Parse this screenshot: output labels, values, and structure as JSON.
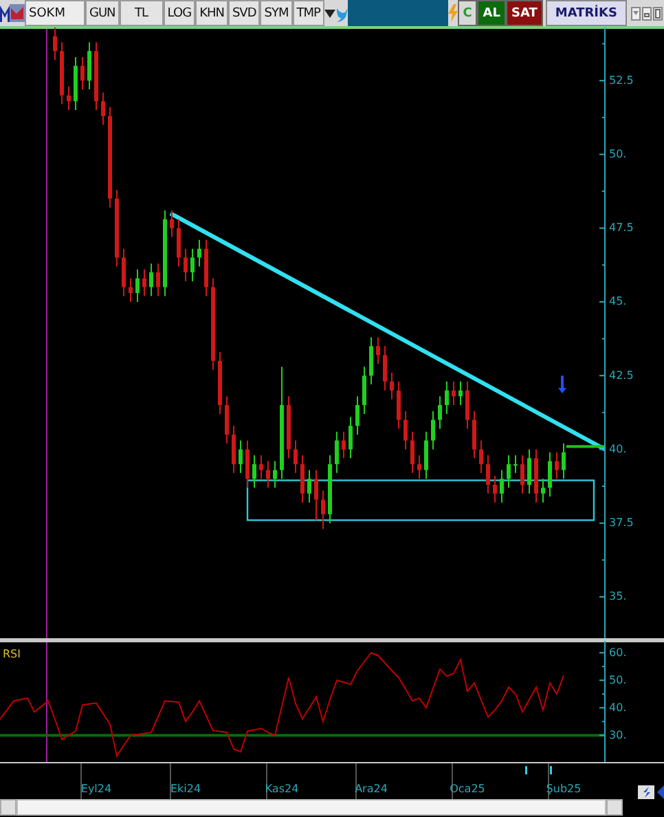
{
  "toolbar": {
    "symbol": "SOKM",
    "buttons": [
      "GUN",
      "TL",
      "LOG",
      "KHN",
      "SVD",
      "SYM",
      "TMP"
    ],
    "actions": [
      {
        "label": "C",
        "kind": "refresh"
      },
      {
        "label": "AL",
        "kind": "buy"
      },
      {
        "label": "SAT",
        "kind": "sell"
      }
    ],
    "brand": "MATRİKS"
  },
  "price_panel": {
    "drawings": [
      {
        "kind": "cursor-line"
      },
      {
        "kind": "trendline"
      },
      {
        "kind": "range-box"
      },
      {
        "kind": "level-line"
      },
      {
        "kind": "arrow"
      }
    ],
    "chart_data": {
      "type": "candlestick",
      "ylim": [
        33.6,
        54.3
      ],
      "yticks": [
        {
          "value": 35,
          "label": "35."
        },
        {
          "value": 37.5,
          "label": "37.5"
        },
        {
          "value": 40,
          "label": "40."
        },
        {
          "value": 42.5,
          "label": "42.5"
        },
        {
          "value": 45,
          "label": "45."
        },
        {
          "value": 47.5,
          "label": "47.5"
        },
        {
          "value": 50,
          "label": "50."
        },
        {
          "value": 52.5,
          "label": "52.5"
        }
      ],
      "categories": [
        null,
        null,
        null,
        null,
        null,
        null,
        null,
        null,
        null,
        null,
        null,
        null,
        null,
        null,
        null,
        null,
        null,
        null,
        null,
        null,
        null,
        null,
        null,
        null,
        null,
        null,
        null,
        null,
        null,
        null,
        null,
        null,
        null,
        null,
        null,
        null,
        null,
        null,
        null,
        null,
        null,
        null,
        null,
        null,
        null,
        null,
        null,
        null,
        null,
        null,
        null,
        null,
        null,
        null,
        null,
        null,
        null,
        null,
        null,
        null,
        null,
        null,
        null,
        null,
        null,
        null,
        null,
        null,
        null,
        null,
        null,
        null,
        null,
        null,
        null
      ],
      "ohlc": [
        [
          54,
          54.3,
          53.2,
          53.5
        ],
        [
          53.5,
          53.8,
          51.7,
          52
        ],
        [
          52,
          52.3,
          51.5,
          51.8
        ],
        [
          51.8,
          53.3,
          51.5,
          53
        ],
        [
          53,
          53.3,
          52.2,
          52.5
        ],
        [
          52.5,
          53.8,
          52.2,
          53.5
        ],
        [
          53.5,
          53.8,
          51.5,
          51.8
        ],
        [
          51.8,
          52.1,
          51,
          51.3
        ],
        [
          51.3,
          51.6,
          48.2,
          48.5
        ],
        [
          48.5,
          48.8,
          46.2,
          46.5
        ],
        [
          46.5,
          46.8,
          45.2,
          45.5
        ],
        [
          45.5,
          45.8,
          45,
          45.3
        ],
        [
          45.3,
          46.1,
          45,
          45.8
        ],
        [
          45.8,
          46.1,
          45.2,
          45.5
        ],
        [
          45.5,
          46.3,
          45.2,
          46
        ],
        [
          46,
          46.3,
          45.2,
          45.5
        ],
        [
          45.5,
          48.1,
          45.2,
          47.8
        ],
        [
          47.8,
          48.1,
          47.2,
          47.5
        ],
        [
          47.5,
          47.8,
          46.2,
          46.5
        ],
        [
          46.5,
          46.8,
          45.7,
          46
        ],
        [
          46,
          46.8,
          45.7,
          46.5
        ],
        [
          46.5,
          47.1,
          46.2,
          46.8
        ],
        [
          46.8,
          47.1,
          45.2,
          45.5
        ],
        [
          45.5,
          45.8,
          42.7,
          43
        ],
        [
          43,
          43.3,
          41.2,
          41.5
        ],
        [
          41.5,
          41.8,
          40.2,
          40.5
        ],
        [
          40.5,
          40.8,
          39.2,
          39.5
        ],
        [
          39.5,
          40.3,
          39.2,
          40
        ],
        [
          40,
          40.3,
          38.7,
          39
        ],
        [
          39,
          39.8,
          38.7,
          39.5
        ],
        [
          39.5,
          39.8,
          39,
          39.3
        ],
        [
          39.3,
          39.6,
          38.7,
          39
        ],
        [
          39,
          39.6,
          38.7,
          39.3
        ],
        [
          39.3,
          42.8,
          39,
          41.5
        ],
        [
          41.5,
          41.8,
          39.7,
          40
        ],
        [
          40,
          40.3,
          39.2,
          39.5
        ],
        [
          39.5,
          39.8,
          38.2,
          38.5
        ],
        [
          38.5,
          39.3,
          38.2,
          39
        ],
        [
          39,
          39.3,
          37.6,
          38.3
        ],
        [
          38.3,
          38.6,
          37.3,
          37.8
        ],
        [
          37.8,
          39.8,
          37.5,
          39.5
        ],
        [
          39.5,
          40.6,
          39.2,
          40.3
        ],
        [
          40.3,
          40.6,
          39.7,
          40
        ],
        [
          40,
          41.1,
          39.7,
          40.8
        ],
        [
          40.8,
          41.8,
          40.5,
          41.5
        ],
        [
          41.5,
          42.8,
          41.2,
          42.5
        ],
        [
          42.5,
          43.8,
          42.2,
          43.5
        ],
        [
          43.5,
          43.8,
          42.9,
          43.2
        ],
        [
          43.2,
          43.5,
          42,
          42.3
        ],
        [
          42.3,
          42.6,
          41.7,
          42
        ],
        [
          42,
          42.3,
          40.7,
          41
        ],
        [
          41,
          41.3,
          40,
          40.3
        ],
        [
          40.3,
          40.6,
          39.2,
          39.5
        ],
        [
          39.5,
          39.8,
          39,
          39.3
        ],
        [
          39.3,
          40.6,
          39,
          40.3
        ],
        [
          40.3,
          41.3,
          40,
          41
        ],
        [
          41,
          41.8,
          40.7,
          41.5
        ],
        [
          41.5,
          42.3,
          41.2,
          42
        ],
        [
          42,
          42.3,
          41.5,
          41.8
        ],
        [
          41.8,
          42.3,
          41.5,
          42
        ],
        [
          42,
          42.3,
          40.7,
          41
        ],
        [
          41,
          41.3,
          39.7,
          40
        ],
        [
          40,
          40.3,
          39.2,
          39.5
        ],
        [
          39.5,
          39.8,
          38.5,
          38.8
        ],
        [
          38.8,
          39.1,
          38.2,
          38.5
        ],
        [
          38.5,
          39.3,
          38.2,
          39
        ],
        [
          39,
          39.8,
          38.7,
          39.5
        ],
        [
          39.5,
          39.8,
          39.2,
          39.5
        ],
        [
          39.5,
          39.8,
          38.5,
          38.8
        ],
        [
          38.8,
          40,
          38.5,
          39.7
        ],
        [
          39.7,
          40,
          38.2,
          38.5
        ],
        [
          38.5,
          39,
          38.2,
          38.7
        ],
        [
          38.7,
          39.9,
          38.4,
          39.6
        ],
        [
          39.6,
          39.9,
          39,
          39.3
        ],
        [
          39.3,
          40.2,
          39,
          39.9
        ]
      ]
    }
  },
  "rsi_panel": {
    "drawings": [
      {
        "kind": "cursor-line"
      },
      {
        "kind": "threshold-line"
      },
      {
        "kind": "event-marker"
      },
      {
        "kind": "event-marker"
      }
    ],
    "chart_data": {
      "type": "line",
      "ylim": [
        20.3,
        64.3
      ],
      "yticks": [
        {
          "value": 30,
          "label": "30."
        },
        {
          "value": 40,
          "label": "40."
        },
        {
          "value": 50,
          "label": "50."
        },
        {
          "value": 60,
          "label": "60."
        }
      ],
      "categories": [
        null,
        null,
        null,
        null,
        null,
        null,
        null,
        null,
        null,
        null,
        null,
        null,
        null,
        null,
        "Eyl24",
        null,
        null,
        null,
        null,
        null,
        null,
        null,
        null,
        null,
        null,
        null,
        null,
        "Eki24",
        null,
        null,
        null,
        null,
        null,
        null,
        null,
        null,
        null,
        null,
        null,
        null,
        null,
        "Kas24",
        null,
        null,
        null,
        null,
        null,
        null,
        null,
        null,
        null,
        null,
        null,
        null,
        "Ara24",
        null,
        null,
        null,
        null,
        null,
        null,
        null,
        null,
        null,
        null,
        null,
        null,
        null,
        "Oca25",
        null,
        null,
        null,
        null,
        null,
        null,
        null,
        null,
        null,
        null,
        null,
        null,
        null,
        "Şub25"
      ],
      "series": [
        {
          "name": "RSI",
          "color": "#c00000",
          "values": [
            35.8,
            39.2,
            42.5,
            43,
            43.5,
            38.5,
            40.5,
            42.5,
            35.8,
            28.5,
            30,
            31.5,
            41,
            41.4,
            41.7,
            37.9,
            34,
            22.5,
            26.3,
            30,
            30.3,
            30.7,
            31,
            36.8,
            42.5,
            42.3,
            42,
            35,
            38.5,
            42.5,
            37.1,
            31.7,
            31.4,
            31,
            25,
            24,
            31.5,
            32,
            32.5,
            31,
            30,
            40.5,
            51,
            41.5,
            36,
            40,
            44,
            35,
            43,
            50,
            49.3,
            48.5,
            53.5,
            56.8,
            60,
            59,
            56.3,
            53.5,
            51,
            46.8,
            42.5,
            43.5,
            40,
            47,
            54,
            51.5,
            52.5,
            57.5,
            46,
            49,
            42.8,
            36.6,
            39.2,
            42.5,
            47.5,
            45,
            38.5,
            43,
            47.5,
            39.2,
            49,
            45,
            51.7
          ]
        }
      ]
    }
  }
}
